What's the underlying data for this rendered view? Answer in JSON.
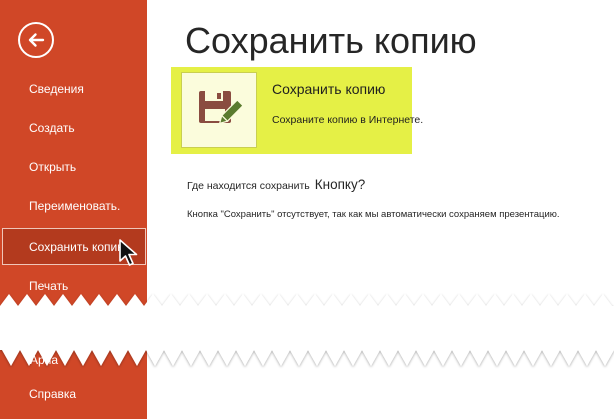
{
  "sidebar": {
    "items": [
      {
        "label": "Сведения"
      },
      {
        "label": "Создать"
      },
      {
        "label": "Открыть"
      },
      {
        "label": "Переименовать."
      },
      {
        "label": "Сохранить копию"
      },
      {
        "label": "Печать"
      }
    ],
    "partial_label": "Ариа",
    "help_label": "Справка",
    "background": "#d04727"
  },
  "main": {
    "title": "Сохранить копию",
    "option": {
      "title": "Сохранить копию",
      "description": "Сохраните копию в Интернете.",
      "icon": "floppy-disk-pencil-icon",
      "highlight_color": "#e5f046"
    },
    "where_text": "Где находится сохранить",
    "where_text_2": "Кнопку?",
    "note": "Кнопка \"Сохранить\" отсутствует, так как мы автоматически сохраняем презентацию."
  }
}
